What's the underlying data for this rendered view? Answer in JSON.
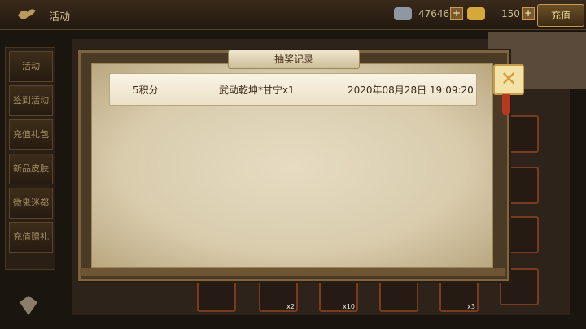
{
  "topbar": {
    "title": "活动",
    "silver": "47646",
    "gold": "150",
    "recharge_label": "充值",
    "plus": "+"
  },
  "sidebar": {
    "items": [
      {
        "label": "活动"
      },
      {
        "label": "签到活动"
      },
      {
        "label": "充值礼包"
      },
      {
        "label": "新品皮肤"
      },
      {
        "label": "微鬼迷都"
      },
      {
        "label": "充值赠礼"
      }
    ]
  },
  "dialog": {
    "title": "抽奖记录",
    "close": "✕",
    "records": [
      {
        "points": "5积分",
        "item": "武动乾坤*甘宁x1",
        "time": "2020年08月28日 19:09:20"
      }
    ]
  },
  "rewards": [
    {
      "qty": ""
    },
    {
      "qty": "x2"
    },
    {
      "qty": "x10"
    },
    {
      "qty": ""
    },
    {
      "qty": "x3"
    },
    {
      "qty": ""
    }
  ],
  "colors": {
    "accent_gold": "#c89b45",
    "parchment": "#e6dcc2",
    "frame": "#7e6540"
  }
}
